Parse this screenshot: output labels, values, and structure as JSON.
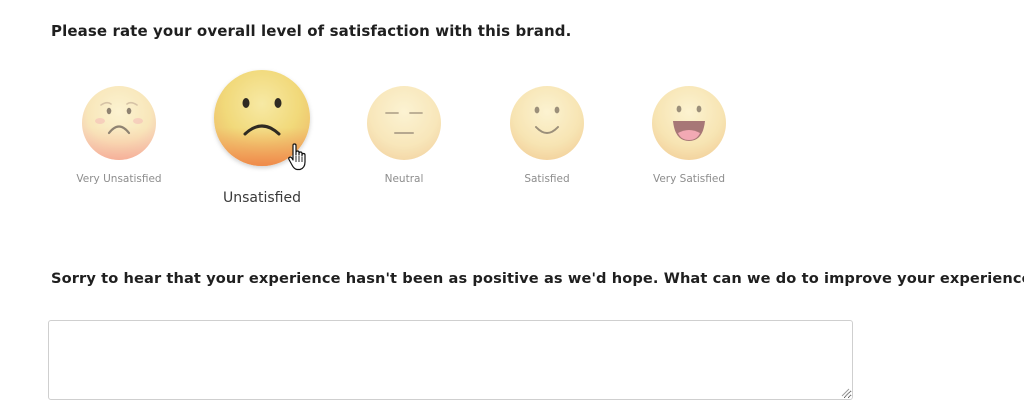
{
  "question_rating": "Please rate your overall level of satisfaction with this brand.",
  "rating_options": [
    {
      "label": "Very Unsatisfied",
      "icon": "very-unsatisfied-face-icon"
    },
    {
      "label": "Unsatisfied",
      "icon": "unsatisfied-face-icon",
      "selected": true
    },
    {
      "label": "Neutral",
      "icon": "neutral-face-icon"
    },
    {
      "label": "Satisfied",
      "icon": "satisfied-face-icon"
    },
    {
      "label": "Very Satisfied",
      "icon": "very-satisfied-face-icon"
    }
  ],
  "selected_rating": "Unsatisfied",
  "question_followup": "Sorry to hear that your experience hasn't been as positive as we'd hope. What can we do to improve your experience?",
  "feedback": {
    "value": "",
    "placeholder": ""
  },
  "colors": {
    "face_yellow": "#f4dd8a",
    "face_orange": "#f29a5a",
    "mouth_pink": "#e6818f",
    "label_gray": "#8d8d8d",
    "question_text": "#1f1f1f"
  }
}
